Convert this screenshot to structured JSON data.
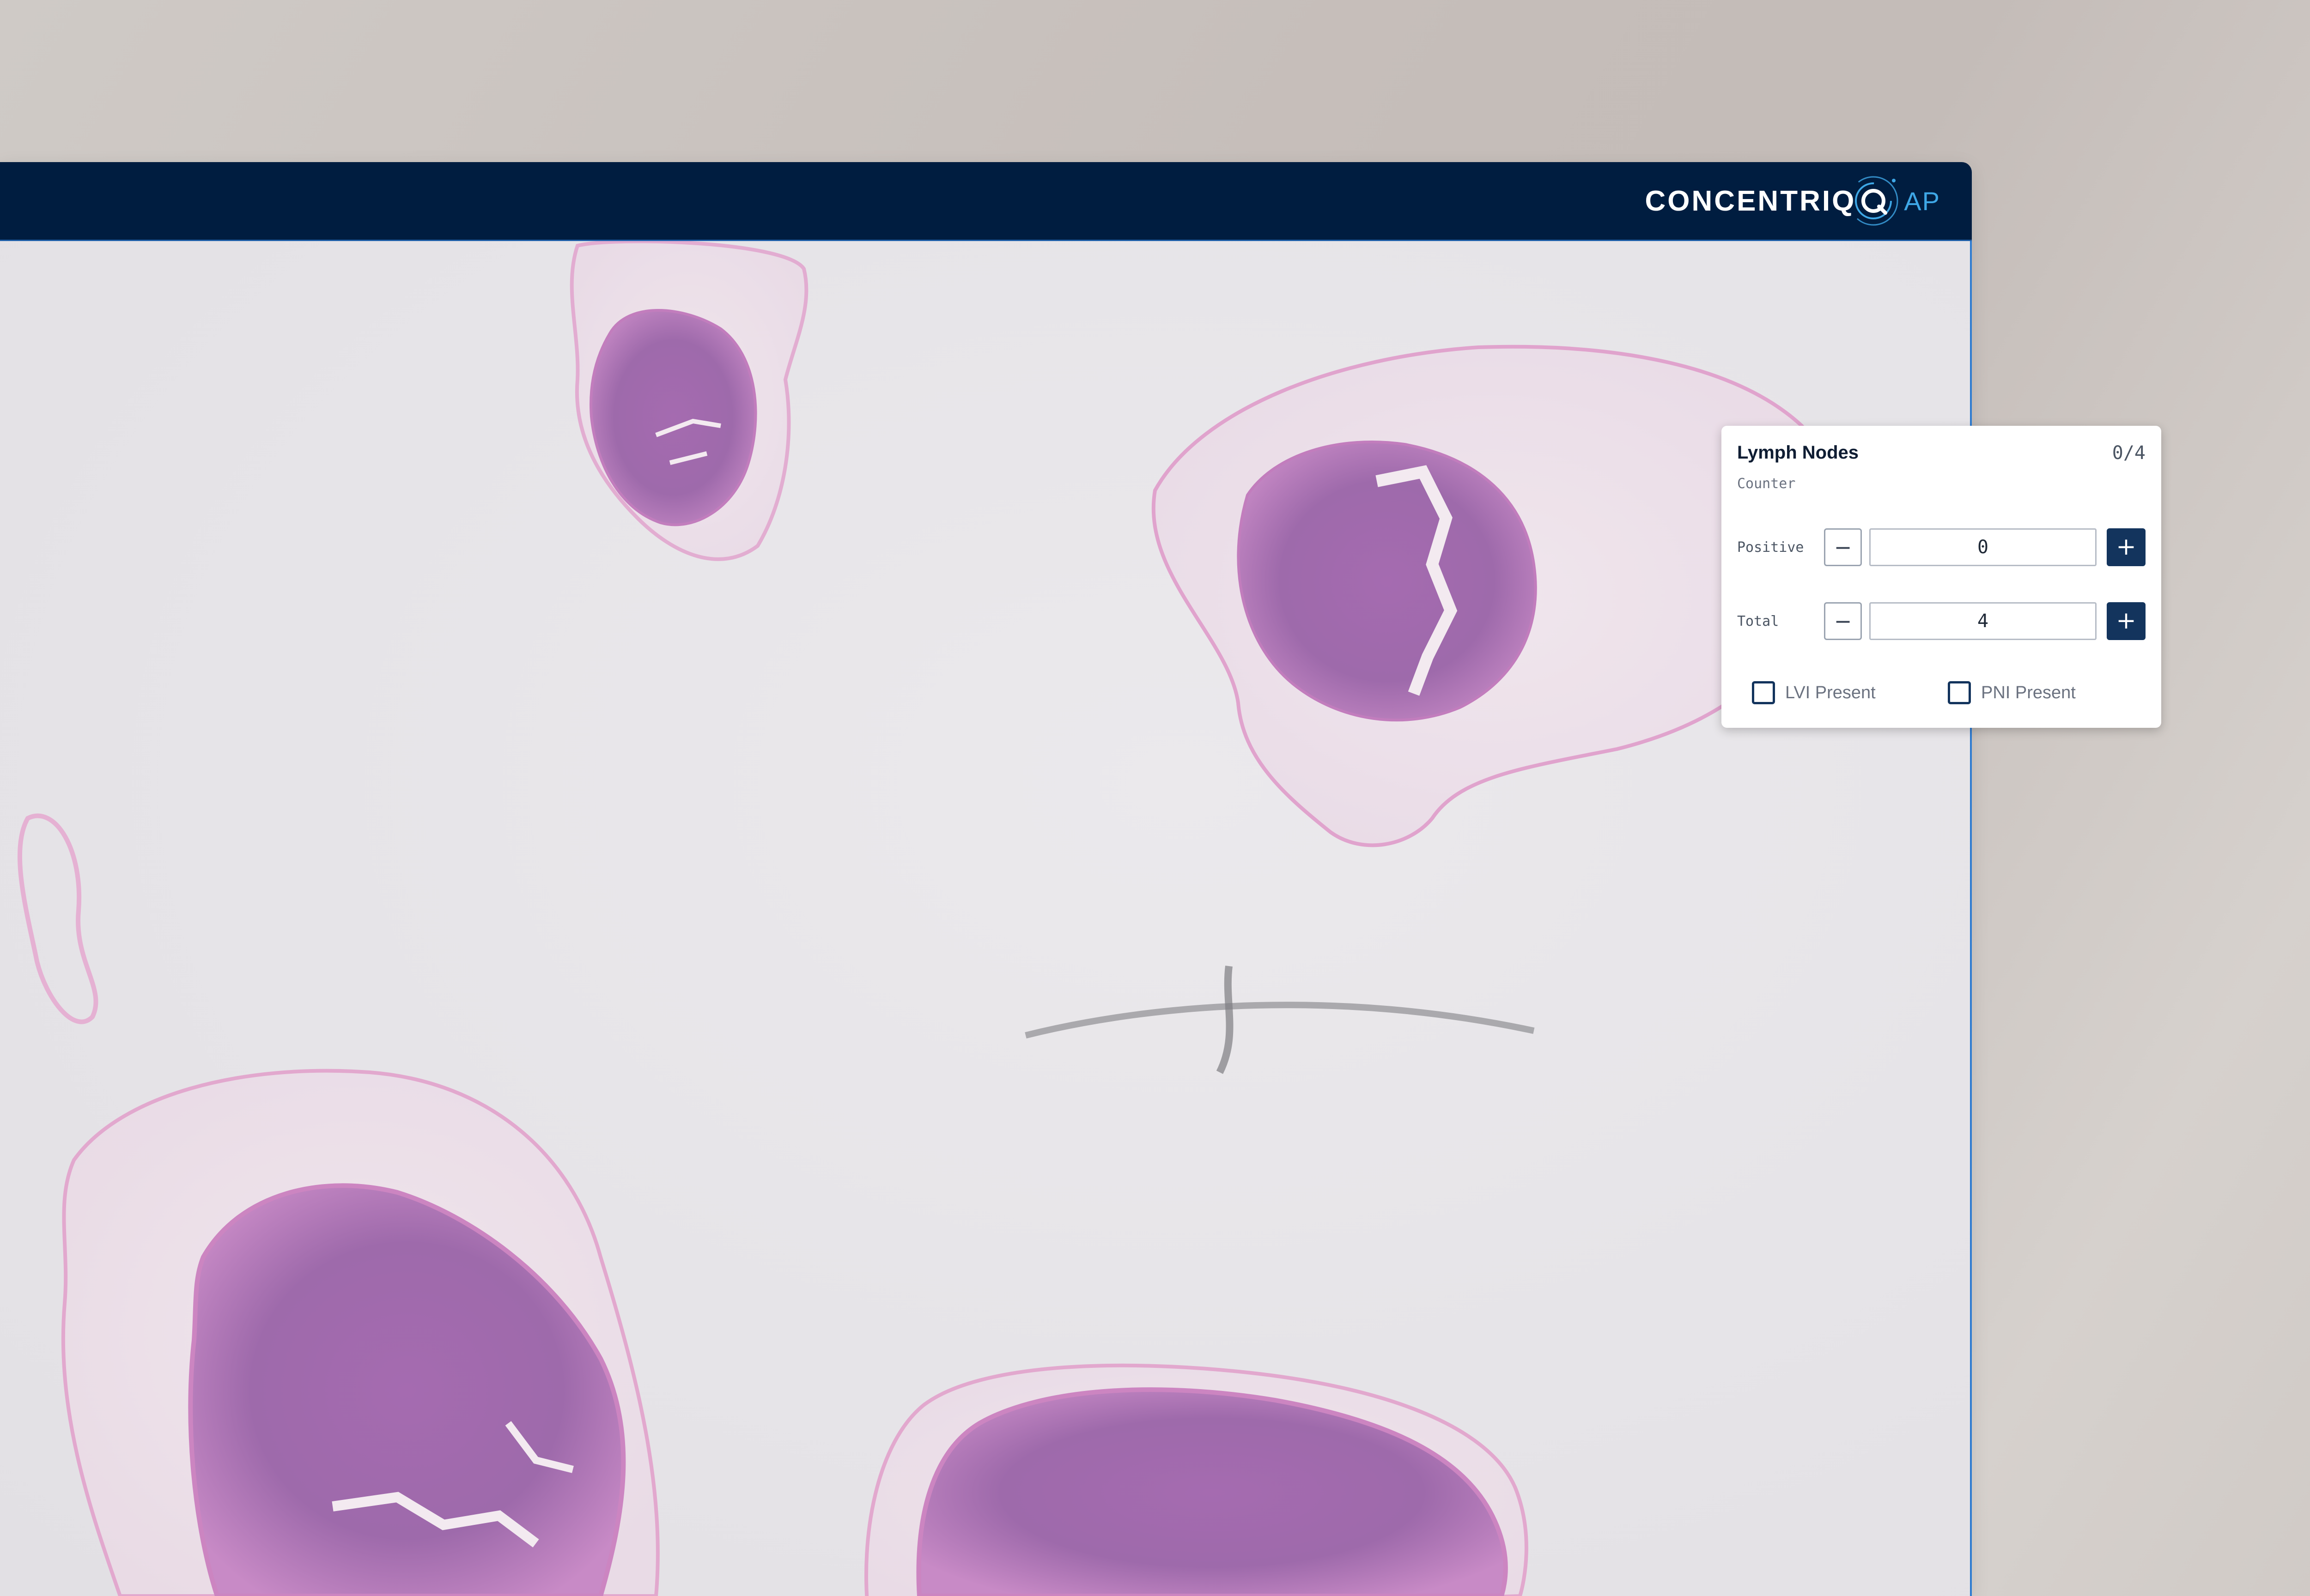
{
  "header": {
    "brand_name": "CONCENTRIQ",
    "brand_suffix": "AP",
    "logo_icon": "concentric-rings-q-icon",
    "background_color": "#001d40",
    "accent_color": "#3ea7e6"
  },
  "viewer": {
    "content": "whole-slide-image-tissue"
  },
  "counter_panel": {
    "title": "Lymph Nodes",
    "count_display": "0/4",
    "subtitle": "Counter",
    "rows": [
      {
        "label": "Positive",
        "value": "0",
        "decrement_symbol": "−",
        "increment_symbol": "+"
      },
      {
        "label": "Total",
        "value": "4",
        "decrement_symbol": "−",
        "increment_symbol": "+"
      }
    ],
    "checkboxes": [
      {
        "label": "LVI Present",
        "checked": false
      },
      {
        "label": "PNI Present",
        "checked": false
      }
    ],
    "button_color": "#13345d"
  }
}
